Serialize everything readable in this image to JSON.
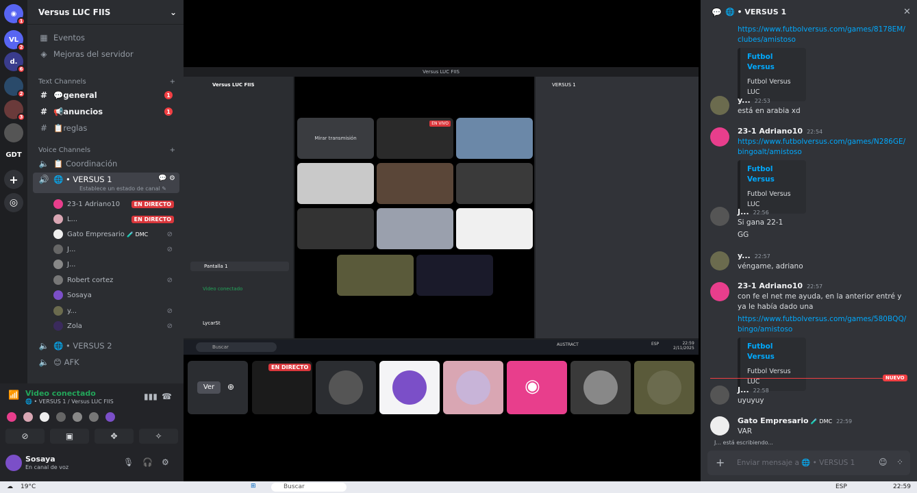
{
  "rail": {
    "servers": [
      {
        "label": "",
        "icon": "discord-icon",
        "badge": "1"
      },
      {
        "label": "VL",
        "badge": "2"
      },
      {
        "label": "d.",
        "badge": "6"
      },
      {
        "label": "",
        "badge": "2"
      },
      {
        "label": "",
        "badge": "3"
      },
      {
        "label": ""
      },
      {
        "label": "GDT"
      }
    ]
  },
  "server": {
    "name": "Versus LUC FIIS"
  },
  "sidebar": {
    "events": "Eventos",
    "boosts": "Mejoras del servidor",
    "text_category": "Text Channels",
    "text_channels": [
      {
        "name": "💬general",
        "badge": "1"
      },
      {
        "name": "📢anuncios",
        "badge": "1"
      },
      {
        "name": "📋reglas"
      }
    ],
    "voice_category": "Voice Channels",
    "voice_channels": [
      {
        "name": "📋 Coordinación"
      },
      {
        "name": "🌐 • VERSUS 1",
        "status": "Establece un estado de canal ✎"
      },
      {
        "name": "🌐 • VERSUS 2"
      },
      {
        "name": "😊 AFK"
      }
    ],
    "voice_users": [
      {
        "name": "23-1 Adriano10",
        "live": "EN DIRECTO",
        "color": "#e83e8c"
      },
      {
        "name": "L...",
        "live": "EN DIRECTO",
        "color": "#d9a6b3"
      },
      {
        "name": "Gato Empresario",
        "badge": "🧪 DMC",
        "color": "#eee"
      },
      {
        "name": "J...",
        "color": "#666"
      },
      {
        "name": "J...",
        "color": "#888"
      },
      {
        "name": "Robert cortez",
        "color": "#777"
      },
      {
        "name": "Sosaya",
        "color": "#7b4fc8"
      },
      {
        "name": "y...",
        "color": "#6b6b4e"
      },
      {
        "name": "Zola",
        "color": "#3a2a5c"
      }
    ]
  },
  "voice_panel": {
    "status": "Video conectado",
    "channel": "🌐 • VERSUS 1 / Versus LUC FIIS",
    "user": "Sosaya",
    "user_status": "En canal de voz"
  },
  "stream": {
    "inner_title": "Versus LUC FIIS",
    "inner_server": "Versus LUC FIIS",
    "inner_button": "Mirar transmisión",
    "inner_live": "EN VIVO",
    "inner_chat_title": "VERSUS 1",
    "inner_search": "Buscar",
    "view_button": "Ver",
    "live_badge": "EN DIRECTO",
    "inner_pantalla": "Pantalla 1",
    "inner_video": "Video conectado",
    "inner_user": "LycarSt",
    "inner_clock": "22:59",
    "inner_date": "2/11/2025",
    "inner_weather": "AUSTRACT",
    "inner_lang": "ESP"
  },
  "chat": {
    "title": "VERSUS 1",
    "messages": [
      {
        "link": "https://www.futbolversus.com/games/8178EM/clubes/amistoso",
        "embed_title": "Futbol Versus",
        "embed_desc": "Futbol Versus LUC"
      },
      {
        "user": "y...",
        "time": "22:53",
        "text": "está en arabia xd"
      },
      {
        "user": "23-1 Adriano10",
        "time": "22:54",
        "link": "https://www.futbolversus.com/games/N286GE/bingoalt/amistoso",
        "embed_title": "Futbol Versus",
        "embed_desc": "Futbol Versus LUC"
      },
      {
        "user": "J...",
        "time": "22:56",
        "text": "Si gana 22-1",
        "text2": "GG"
      },
      {
        "user": "y...",
        "time": "22:57",
        "text": "véngame, adriano"
      },
      {
        "user": "23-1 Adriano10",
        "time": "22:57",
        "text": "con fe el net me ayuda, en la anterior entré y ya le había dado una",
        "link": "https://www.futbolversus.com/games/580BQQ/bingo/amistoso",
        "embed_title": "Futbol Versus",
        "embed_desc": "Futbol Versus LUC"
      },
      {
        "user": "J...",
        "time": "22:58",
        "text": "uyuyuy"
      },
      {
        "user": "Gato Empresario",
        "badge": "🧪 DMC",
        "time": "22:59",
        "text": "VAR"
      }
    ],
    "new_label": "NUEVO",
    "typing": "J... está escribiendo...",
    "input_placeholder": "Enviar mensaje a 🌐 • VERSUS 1"
  },
  "taskbar": {
    "weather": "19°C",
    "search": "Buscar",
    "lang": "ESP",
    "clock": "22:59"
  },
  "colors": {
    "bg": "#313338",
    "sidebar": "#2b2d31",
    "live": "#da373c",
    "link": "#00a8fc",
    "green": "#23a55a"
  }
}
